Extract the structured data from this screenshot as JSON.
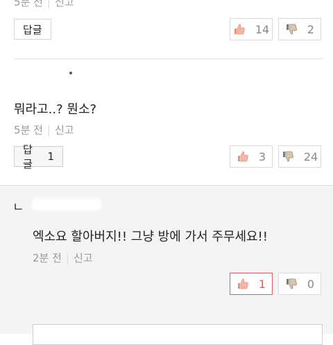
{
  "comments": [
    {
      "time": "5분 전",
      "report": "신고",
      "reply_label": "답글",
      "reply_count": "",
      "likes": "14",
      "dislikes": "2"
    },
    {
      "text": "뭐라고..? 뭔소?",
      "time": "5분 전",
      "report": "신고",
      "reply_label": "답글",
      "reply_count": "1",
      "likes": "3",
      "dislikes": "24"
    },
    {
      "reply_marker": "ㄴ",
      "text": "엑소요 할아버지!! 그냥 방에 가서 주무세요!!",
      "time": "2분 전",
      "report": "신고",
      "likes": "1",
      "dislikes": "0"
    }
  ],
  "colors": {
    "accent": "#e05a5a",
    "like_icon": "#e8927c",
    "dislike_icon": "#6f7f8a"
  }
}
